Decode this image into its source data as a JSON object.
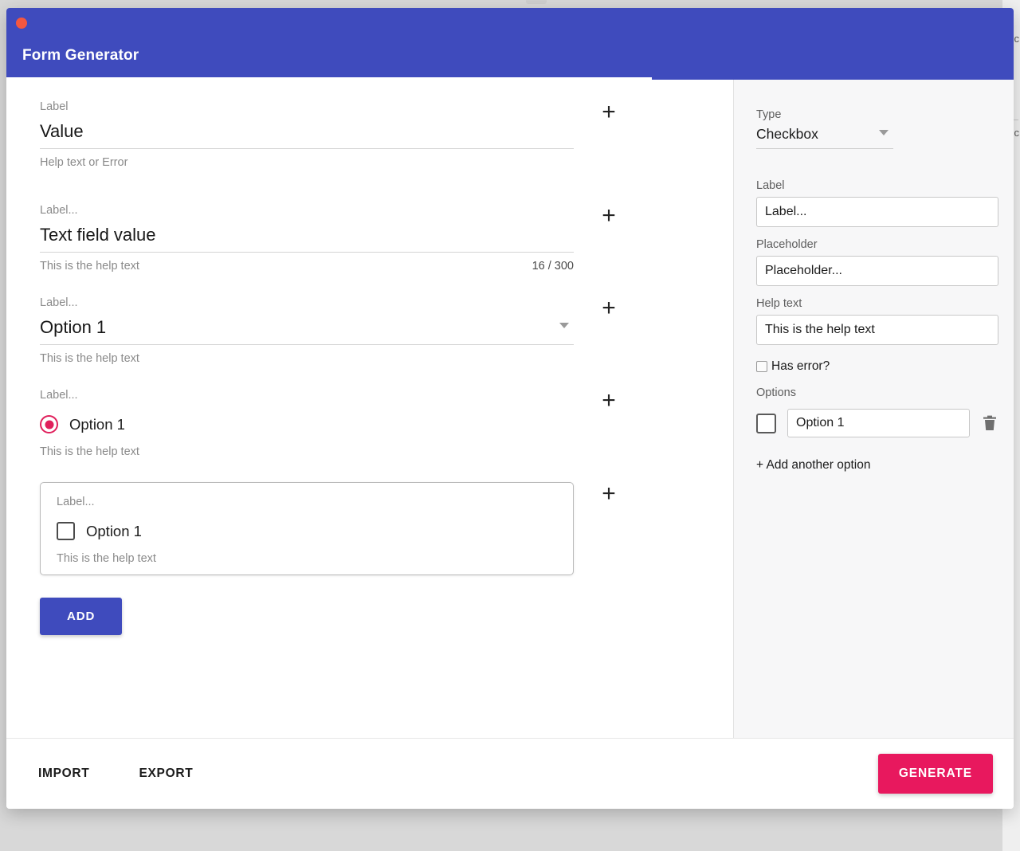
{
  "window": {
    "title": "Form Generator",
    "traffic_dot": "close-dot",
    "colors": {
      "header": "#3f4bbd",
      "primary": "#3f4bbd",
      "accent": "#e8185e",
      "radio_selected": "#e0205c",
      "sidebar_bg": "#f7f7f8"
    }
  },
  "canvas": {
    "add_icon": "+",
    "fields": [
      {
        "label": "Label",
        "value": "Value",
        "help": "Help text or Error",
        "counter": "",
        "kind": "text"
      },
      {
        "label": "Label...",
        "value": "Text field value",
        "help": "This is the help text",
        "counter": "16 / 300",
        "kind": "text"
      },
      {
        "label": "Label...",
        "value": "Option 1",
        "help": "This is the help text",
        "counter": "",
        "kind": "select"
      },
      {
        "label": "Label...",
        "value": "Option 1",
        "help": "This is the help text",
        "counter": "",
        "kind": "radio"
      },
      {
        "label": "Label...",
        "value": "Option 1",
        "help": "This is the help text",
        "counter": "",
        "kind": "checkbox",
        "selected": true
      }
    ],
    "add_button": "ADD"
  },
  "sidebar": {
    "type_label": "Type",
    "type_value": "Checkbox",
    "label_label": "Label",
    "label_value": "Label...",
    "placeholder_label": "Placeholder",
    "placeholder_value": "Placeholder...",
    "help_label": "Help text",
    "help_value": "This is the help text",
    "has_error_label": "Has error?",
    "has_error_checked": false,
    "options_label": "Options",
    "options": [
      {
        "value": "Option 1",
        "checked": false
      }
    ],
    "add_option_label": "+ Add another option",
    "delete_icon": "trash-icon",
    "dropdown_icon": "chevron-down-icon"
  },
  "footer": {
    "import_label": "IMPORT",
    "export_label": "EXPORT",
    "generate_label": "GENERATE"
  },
  "background": {
    "peek_glyph": "c",
    "peek_glyph2": "c"
  }
}
